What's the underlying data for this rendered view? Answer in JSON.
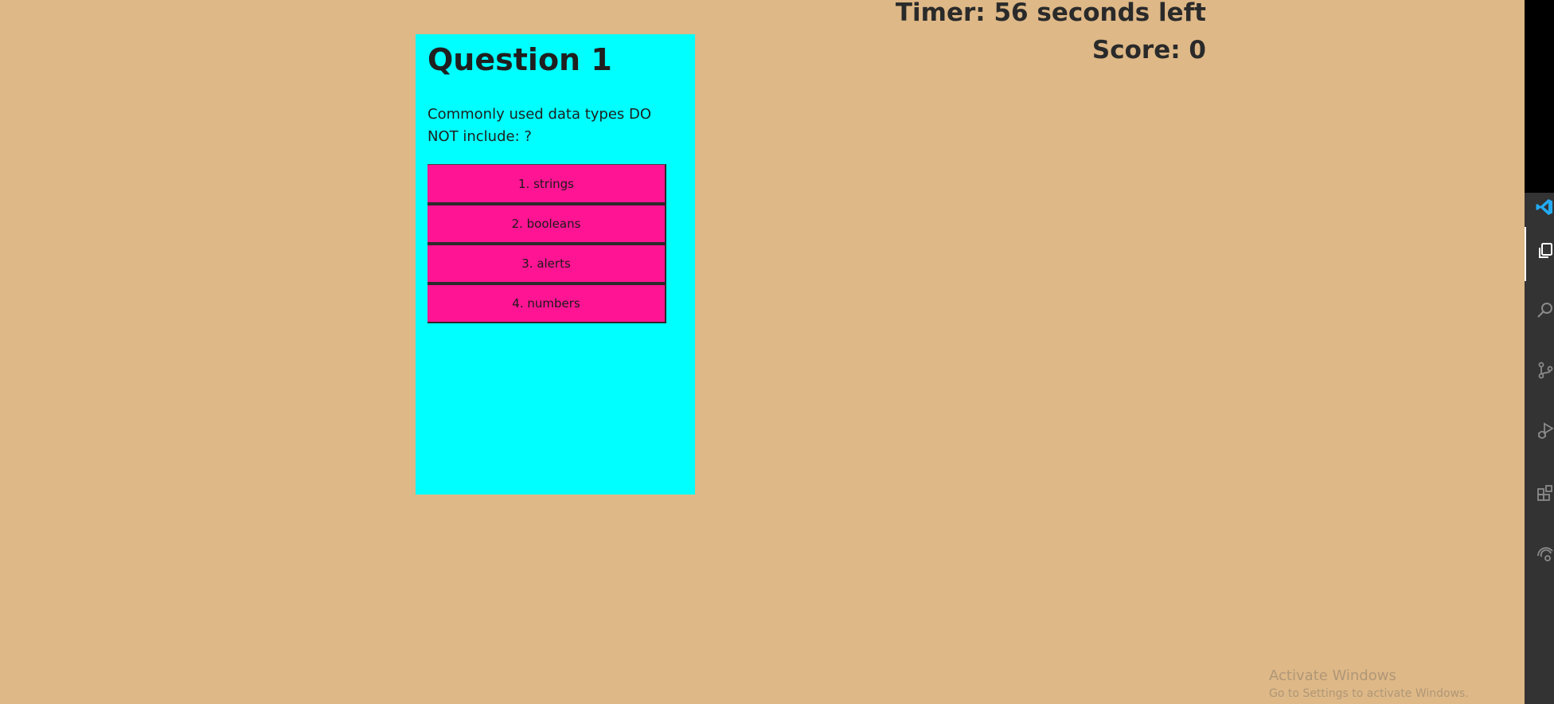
{
  "header": {
    "timer_text": "Timer: 56 seconds left",
    "score_text": "Score: 0"
  },
  "quiz": {
    "title": "Question 1",
    "question": "Commonly used data types DO NOT include: ?",
    "answers": [
      {
        "label": "1. strings"
      },
      {
        "label": "2. booleans"
      },
      {
        "label": "3. alerts"
      },
      {
        "label": "4. numbers"
      }
    ]
  },
  "colors": {
    "background": "#deb887",
    "card": "#00ffff",
    "answer_button": "#ff1493",
    "activity_bar": "#333333",
    "vscode_blue": "#23a9f2"
  },
  "activity_bar": {
    "icons": [
      "vscode-logo-icon",
      "explorer-icon",
      "search-icon",
      "source-control-icon",
      "run-debug-icon",
      "extensions-icon",
      "remote-explorer-icon"
    ]
  },
  "watermark": {
    "title": "Activate Windows",
    "subtitle": "Go to Settings to activate Windows."
  }
}
